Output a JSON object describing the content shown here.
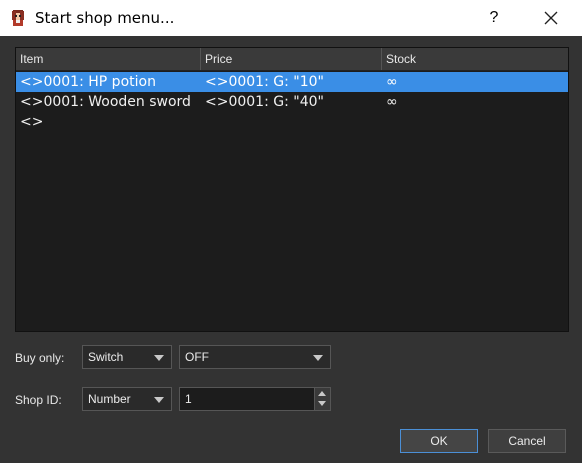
{
  "window": {
    "title": "Start shop menu...",
    "help_label": "?",
    "icons": {
      "app": "character-sprite-icon",
      "close": "close-icon"
    }
  },
  "table": {
    "columns": [
      "Item",
      "Price",
      "Stock"
    ],
    "rows": [
      {
        "item": "<>0001: HP potion",
        "price": "<>0001: G: \"10\"",
        "stock": "∞",
        "selected": true
      },
      {
        "item": "<>0001: Wooden sword",
        "price": "<>0001: G: \"40\"",
        "stock": "∞",
        "selected": false
      },
      {
        "item": "<>",
        "price": "",
        "stock": "",
        "selected": false
      }
    ]
  },
  "form": {
    "buy_only": {
      "label": "Buy only:",
      "type_value": "Switch",
      "value": "OFF"
    },
    "shop_id": {
      "label": "Shop ID:",
      "type_value": "Number",
      "value": "1"
    }
  },
  "buttons": {
    "ok": "OK",
    "cancel": "Cancel"
  },
  "colors": {
    "selection": "#3a8ee6",
    "background": "#333333",
    "table_bg": "#1c1c1c",
    "default_button_border": "#4b8fd6"
  }
}
